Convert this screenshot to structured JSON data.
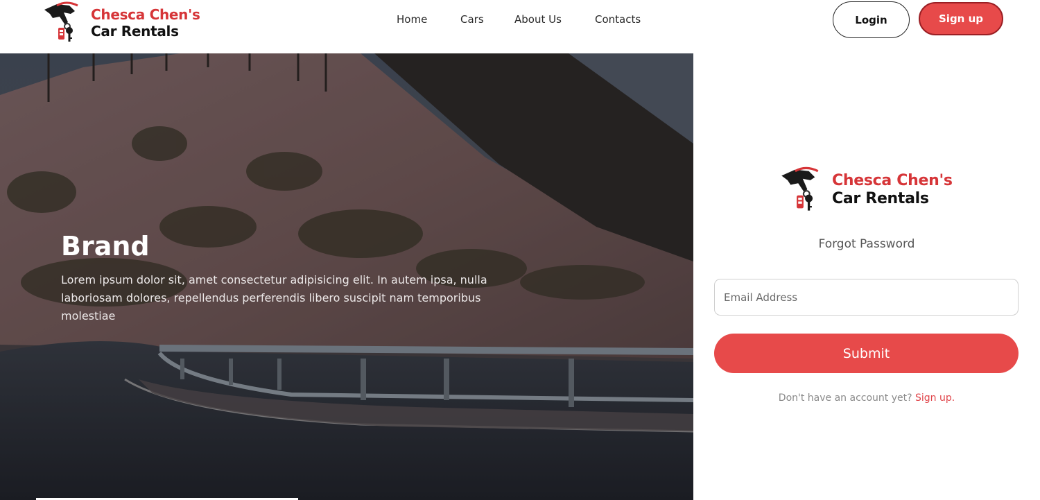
{
  "brand": {
    "line1": "Chesca Chen's",
    "line2": "Car Rentals",
    "logo_icon": "car-key-icon",
    "logo_arc_text": "CHESCA CHEN'S"
  },
  "nav": {
    "items": [
      {
        "label": "Home"
      },
      {
        "label": "Cars"
      },
      {
        "label": "About Us"
      },
      {
        "label": "Contacts"
      }
    ],
    "login_label": "Login",
    "signup_label": "Sign up"
  },
  "hero": {
    "title": "Brand",
    "text": "Lorem ipsum dolor sit, amet consectetur adipisicing elit. In autem ipsa, nulla laboriosam dolores, repellendus perferendis libero suscipit nam temporibus molestiae"
  },
  "form": {
    "heading": "Forgot Password",
    "email_placeholder": "Email Address",
    "email_value": "",
    "submit_label": "Submit",
    "no_account_text": "Don't have an account yet?",
    "signup_link": "Sign up."
  },
  "colors": {
    "accent": "#e74a4a",
    "accent_dark": "#9b1f24",
    "brand_red": "#d63538",
    "text_dark": "#111111"
  }
}
